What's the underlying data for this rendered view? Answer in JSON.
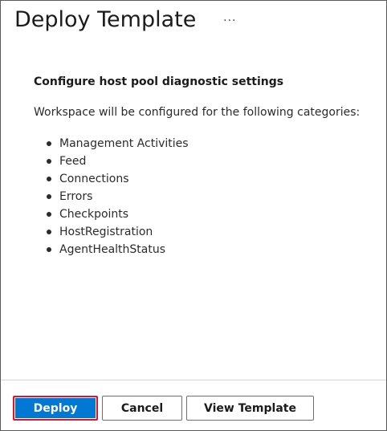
{
  "header": {
    "title": "Deploy Template",
    "more_label": "···"
  },
  "content": {
    "section_title": "Configure host pool diagnostic settings",
    "description": "Workspace will be configured for the following categories:",
    "categories": [
      "Management Activities",
      "Feed",
      "Connections",
      "Errors",
      "Checkpoints",
      "HostRegistration",
      "AgentHealthStatus"
    ]
  },
  "footer": {
    "deploy_label": "Deploy",
    "cancel_label": "Cancel",
    "view_template_label": "View Template"
  },
  "colors": {
    "primary": "#0078d4",
    "highlight_border": "#e81123"
  }
}
